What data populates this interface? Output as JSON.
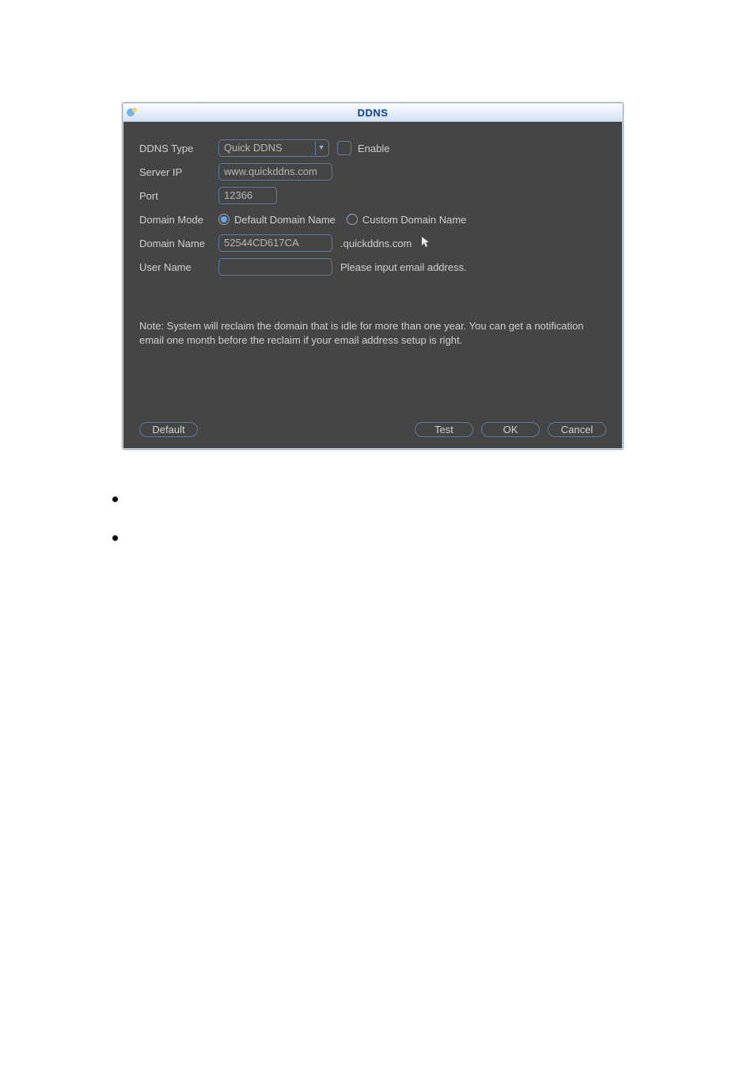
{
  "dialog": {
    "title": "DDNS",
    "labels": {
      "ddns_type": "DDNS Type",
      "server_ip": "Server IP",
      "port": "Port",
      "domain_mode": "Domain Mode",
      "domain_name": "Domain Name",
      "user_name": "User Name"
    },
    "values": {
      "ddns_type": "Quick DDNS",
      "enable_label": "Enable",
      "server_ip": "www.quickddns.com",
      "port": "12366",
      "domain_mode_default": "Default Domain Name",
      "domain_mode_custom": "Custom Domain Name",
      "domain_name": "52544CD617CA",
      "domain_suffix": ".quickddns.com",
      "user_name": "",
      "user_name_hint": "Please input email address."
    },
    "note": "Note: System will reclaim the domain that is idle for more than one year. You can get a notification email one month before the reclaim if your email address setup is right.",
    "buttons": {
      "default": "Default",
      "test": "Test",
      "ok": "OK",
      "cancel": "Cancel"
    }
  }
}
